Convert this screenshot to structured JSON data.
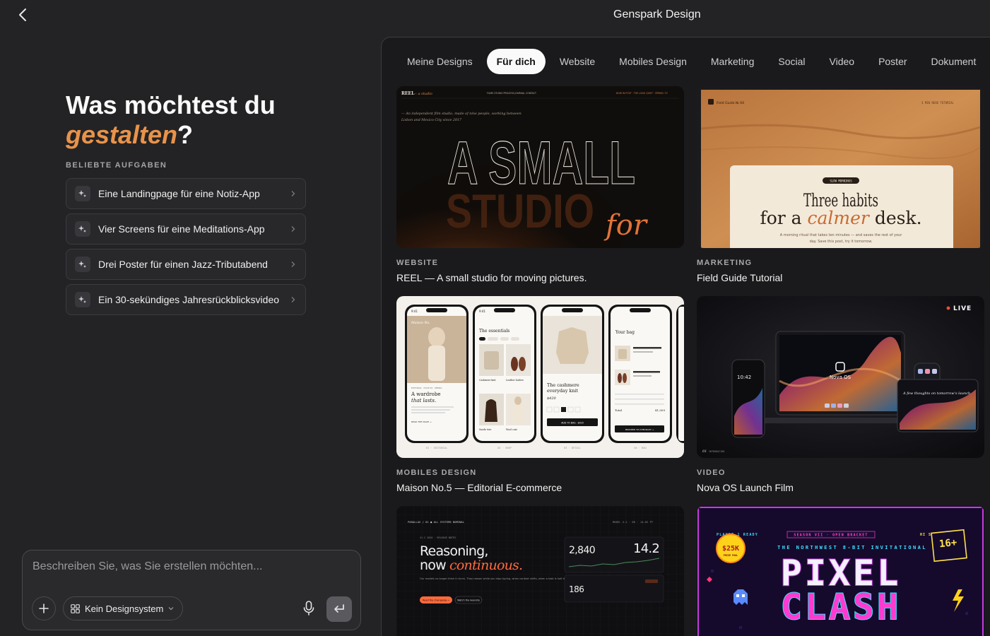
{
  "app": {
    "title": "Genspark Design"
  },
  "hero": {
    "line1": "Was möchtest du",
    "accent": "gestalten",
    "suffix": "?"
  },
  "tasks": {
    "label": "BELIEBTE AUFGABEN",
    "items": [
      {
        "label": "Eine Landingpage für eine Notiz-App"
      },
      {
        "label": "Vier Screens für eine Meditations-App"
      },
      {
        "label": "Drei Poster für einen Jazz-Tributabend"
      },
      {
        "label": "Ein 30-sekündiges Jahresrückblicksvideo"
      }
    ]
  },
  "composer": {
    "placeholder": "Beschreiben Sie, was Sie erstellen möchten...",
    "design_system": "Kein Designsystem"
  },
  "tabs": [
    {
      "label": "Meine Designs"
    },
    {
      "label": "Für dich"
    },
    {
      "label": "Website"
    },
    {
      "label": "Mobiles Design"
    },
    {
      "label": "Marketing"
    },
    {
      "label": "Social"
    },
    {
      "label": "Video"
    },
    {
      "label": "Poster"
    },
    {
      "label": "Dokument"
    }
  ],
  "active_tab": "Für dich",
  "cards": [
    {
      "category": "WEBSITE",
      "title": "REEL — A small studio for moving pictures.",
      "thumb": {
        "brand": "REEL",
        "brand_sub": "— a studio",
        "nav": "FILMS   STUDIO   PROCESS   JOURNAL   CONTACT",
        "nav_right": "NOW IN POST · THE LONG QUIET · SPRING '27",
        "intro": "— An independent film studio, made of nine people, working between",
        "intro2": "Lisbon and Mexico City since 2017",
        "headline": "A SMALL",
        "ghost": "STUDIO",
        "script": "for"
      }
    },
    {
      "category": "MARKETING",
      "title": "Field Guide Tutorial",
      "thumb": {
        "badge": "Field Guide № 04",
        "top_right": "3 MIN READ      TUTORIAL",
        "pill": "SLOW MORNINGS",
        "line1": "Three habits",
        "line2a": "for a ",
        "line2b": "calmer",
        "line2c": " desk.",
        "sub1": "A morning ritual that takes ten minutes — and saves the rest of your",
        "sub2": "day. Save this post, try it tomorrow."
      }
    },
    {
      "category": "MOBILES DESIGN",
      "title": "Maison No.5 — Editorial E-commerce",
      "thumb": {
        "time": "9:41",
        "p1_brand": "Maison No.",
        "p1_kicker": "EDITORIAL · ISSUE 04 · SPRING",
        "p1_head1": "A wardrobe",
        "p1_head2": "that lasts.",
        "p1_cta": "READ THE ISSUE →",
        "p2_head": "The essentials",
        "p2_item1": "Cashmere knit",
        "p2_item2": "Leather loafers",
        "p2_item3": "Suede tote",
        "p2_item4": "Wool coat",
        "p3_head1": "The cashmere",
        "p3_head2": "everyday knit",
        "p3_price": "$420",
        "p3_btn": "ADD TO BAG · $420",
        "p4_head": "Your bag",
        "p4_total": "Total",
        "p4_total_val": "$1,009",
        "p4_btn": "PROCEED TO CHECKOUT →",
        "labels": [
          "01 · EDITORIAL",
          "02 · SHOP",
          "03 · DETAIL",
          "04 · BAG"
        ]
      }
    },
    {
      "category": "VIDEO",
      "title": "Nova OS Launch Film",
      "thumb": {
        "live": "LIVE",
        "brand": "Nova OS",
        "clock": "10:42",
        "tablet_text": "A few thoughts on tomorrow's launch",
        "frame": "01",
        "frame_label": "INTRODUCING"
      }
    },
    {
      "category": "",
      "title": "",
      "thumb": {
        "top_left": "PARALLAX / 01   ● ALL SYSTEMS NOMINAL",
        "top_right": "MODEL 4.2 · 8K   ·   14:02 PT",
        "kicker": "41.2 2026 · RELEASE NOTES",
        "head1": "Reasoning,",
        "head2a": "now ",
        "head2b": "continuous.",
        "body": "Our models no longer think in turns. They reason while you stop typing, when context shifts, when a task is half done.",
        "btn1": "Read the changelog →",
        "btn2": "Watch the keynote",
        "stat1": "2,840",
        "stat2": "14.2",
        "stat3": "186"
      }
    },
    {
      "category": "",
      "title": "",
      "thumb": {
        "top_left": "PLAYER 1 READY",
        "season": "SEASON VII · OPEN BRACKET",
        "hiscore": "HI SCORE",
        "prize": "$25K",
        "prize_label": "PRIZE POOL",
        "age": "16+",
        "marquee": "THE NORTHWEST 8-BIT INVITATIONAL",
        "word1": "PIXEL",
        "word2": "CLASH"
      }
    }
  ]
}
